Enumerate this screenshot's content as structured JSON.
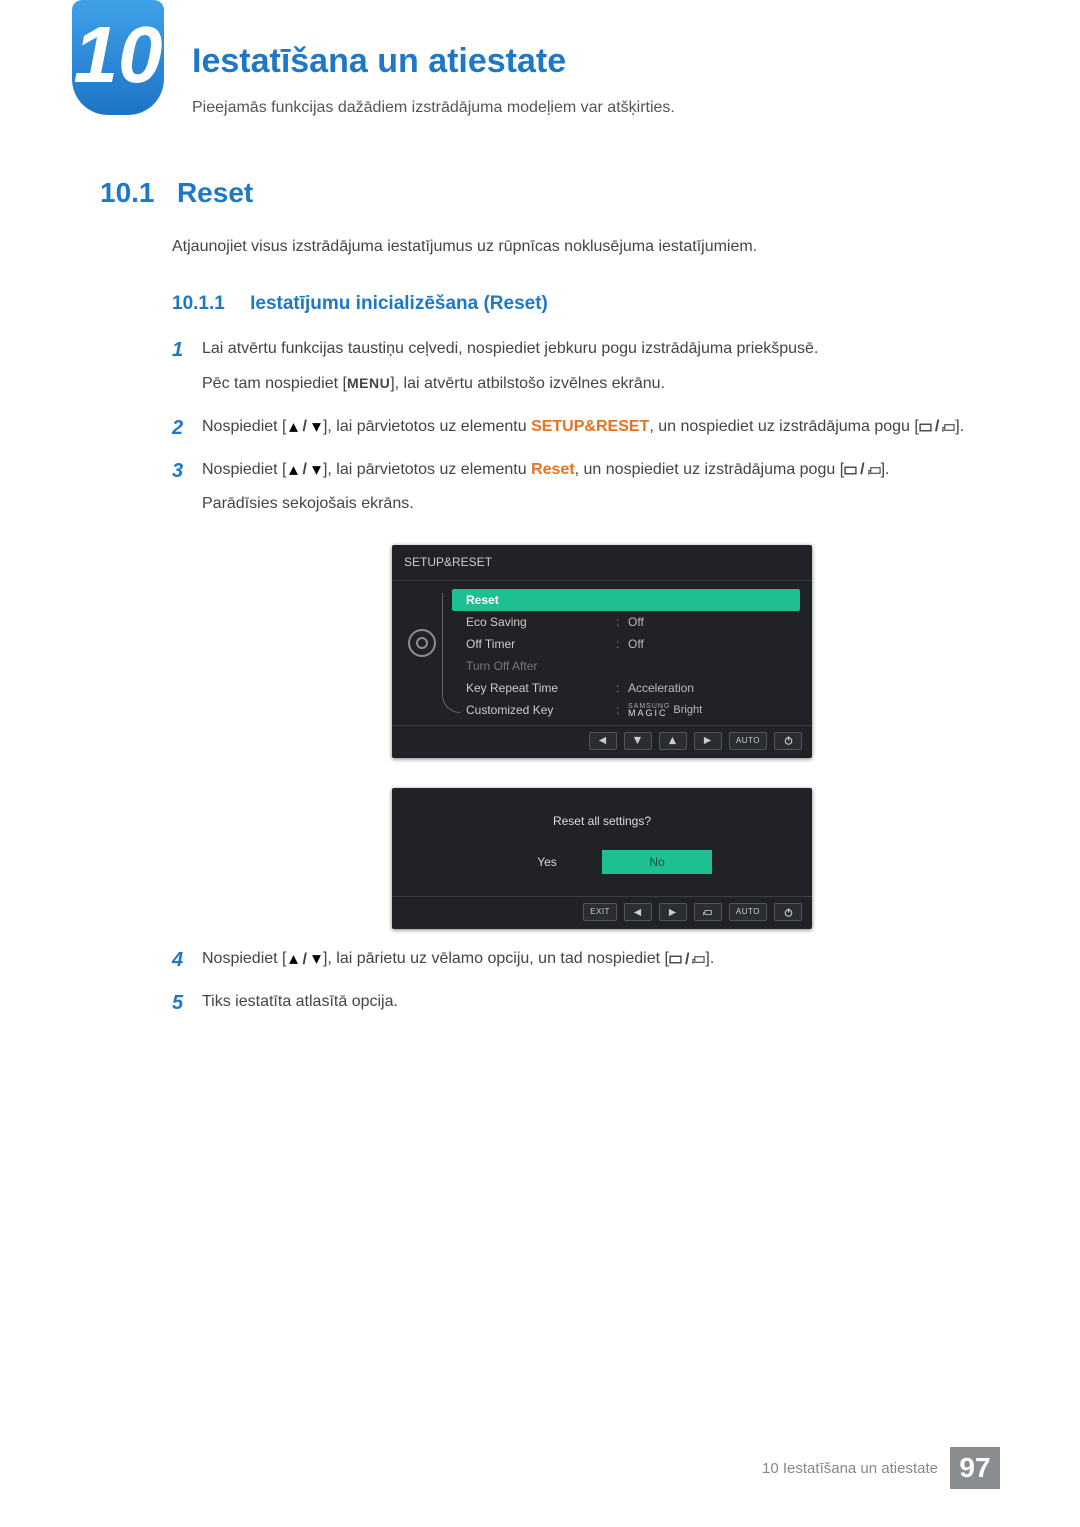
{
  "chapter": {
    "number": "10",
    "title": "Iestatīšana un atiestate",
    "subtitle": "Pieejamās funkcijas dažādiem izstrādājuma modeļiem var atšķirties."
  },
  "section": {
    "number": "10.1",
    "title": "Reset",
    "description": "Atjaunojiet visus izstrādājuma iestatījumus uz rūpnīcas noklusējuma iestatījumiem."
  },
  "subsection": {
    "number": "10.1.1",
    "title": "Iestatījumu inicializēšana (Reset)"
  },
  "steps": {
    "s1_main": "Lai atvērtu funkcijas taustiņu ceļvedi, nospiediet jebkuru pogu izstrādājuma priekšpusē.",
    "s1_extra_a": "Pēc tam nospiediet [",
    "s1_menu": "MENU",
    "s1_extra_b": "], lai atvērtu atbilstošo izvēlnes ekrānu.",
    "s2_a": "Nospiediet [",
    "s2_b": "], lai pārvietotos uz elementu ",
    "s2_target": "SETUP&RESET",
    "s2_c": ", un nospiediet uz izstrādājuma pogu [",
    "s2_d": "].",
    "s3_a": "Nospiediet [",
    "s3_b": "], lai pārvietotos uz elementu ",
    "s3_target": "Reset",
    "s3_c": ", un nospiediet uz izstrādājuma pogu [",
    "s3_d": "].",
    "s3_extra": "Parādīsies sekojošais ekrāns.",
    "s4_a": "Nospiediet [",
    "s4_b": "], lai pārietu uz vēlamo opciju, un tad nospiediet [",
    "s4_c": "].",
    "s5": "Tiks iestatīta atlasītā opcija."
  },
  "osd": {
    "title": "SETUP&RESET",
    "rows": [
      {
        "label": "Reset",
        "value": "",
        "selected": true
      },
      {
        "label": "Eco Saving",
        "value": "Off"
      },
      {
        "label": "Off Timer",
        "value": "Off"
      },
      {
        "label": "Turn Off After",
        "value": "",
        "dim": true
      },
      {
        "label": "Key Repeat Time",
        "value": "Acceleration"
      },
      {
        "label": "Customized Key",
        "value": "MAGIC_BRIGHT"
      }
    ],
    "footer": {
      "auto": "AUTO"
    }
  },
  "confirm": {
    "question": "Reset all settings?",
    "yes": "Yes",
    "no": "No",
    "exit": "EXIT",
    "auto": "AUTO"
  },
  "footer": {
    "text": "10 Iestatīšana un atiestate",
    "page": "97"
  },
  "svg_label": {
    "up": "up-triangle",
    "down": "down-triangle",
    "rect": "rect-icon",
    "enter": "enter-icon",
    "left": "left-triangle",
    "right": "right-triangle",
    "power": "power-icon"
  }
}
